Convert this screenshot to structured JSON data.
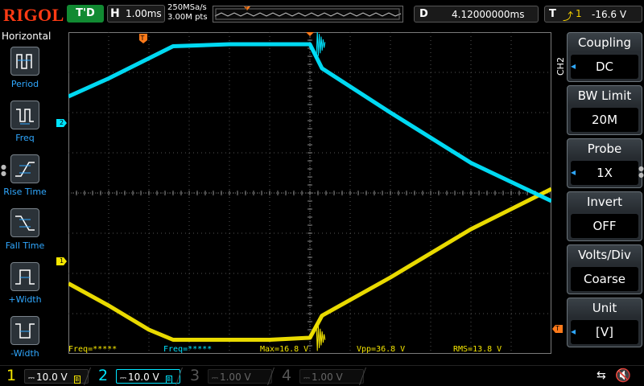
{
  "top": {
    "logo": "RIGOL",
    "run_status": "T'D",
    "timebase_letter": "H",
    "timebase": "1.00ms",
    "sample_rate": "250MSa/s",
    "mem_depth": "3.00M pts",
    "delay_letter": "D",
    "delay": "4.12000000ms",
    "trigger_letter": "T",
    "trigger_source": "1",
    "trigger_level": "-16.6 V"
  },
  "left": {
    "title": "Horizontal",
    "items": [
      {
        "label": "Period"
      },
      {
        "label": "Freq"
      },
      {
        "label": "Rise Time"
      },
      {
        "label": "Fall Time"
      },
      {
        "label": "+Width"
      },
      {
        "label": "-Width"
      }
    ]
  },
  "right": {
    "channel_tag": "CH2",
    "menus": [
      {
        "title": "Coupling",
        "value": "DC",
        "has_arrow": true
      },
      {
        "title": "BW Limit",
        "value": "20M",
        "has_arrow": false
      },
      {
        "title": "Probe",
        "value": "1X",
        "has_arrow": true
      },
      {
        "title": "Invert",
        "value": "OFF",
        "has_arrow": false
      },
      {
        "title": "Volts/Div",
        "value": "Coarse",
        "has_arrow": false
      },
      {
        "title": "Unit",
        "value": "[V]",
        "has_arrow": true
      }
    ]
  },
  "grid_markers": {
    "trigger_pos": "T",
    "ch2_marker": "2",
    "ch1_marker": "1",
    "trig_level_marker": "T"
  },
  "measurements": [
    {
      "text": "Freq=*****",
      "color": "#f5e600"
    },
    {
      "text": "Freq=*****",
      "color": "#00e5ff"
    },
    {
      "text": "Max=16.8 V",
      "color": "#f5e600"
    },
    {
      "text": "Vpp=36.8 V",
      "color": "#f5e600"
    },
    {
      "text": "RMS=13.8 V",
      "color": "#f5e600"
    }
  ],
  "channels": [
    {
      "num": "1",
      "scale": "10.0 V",
      "color": "#f5e600",
      "active": true
    },
    {
      "num": "2",
      "scale": "10.0 V",
      "color": "#00e5ff",
      "active": true
    },
    {
      "num": "3",
      "scale": "1.00 V",
      "color": "#ff40c0",
      "active": false
    },
    {
      "num": "4",
      "scale": "1.00 V",
      "color": "#3a7fff",
      "active": false
    }
  ],
  "colors": {
    "ch1": "#f5e600",
    "ch2": "#00e5ff",
    "trigger_marker": "#ff7a1a",
    "accent": "#30a8ff"
  },
  "chart_data": {
    "type": "line",
    "grid": true,
    "x_divisions": 12,
    "y_divisions": 8,
    "series": [
      {
        "channel": "1",
        "x_div": [
          0,
          1,
          2,
          2.6,
          4,
          5,
          6,
          6.3,
          8,
          10,
          12
        ],
        "y_div": [
          -2.25,
          -2.8,
          -3.4,
          -3.65,
          -3.65,
          -3.65,
          -3.6,
          -3.05,
          -2.1,
          -0.9,
          0.1
        ]
      },
      {
        "channel": "2",
        "x_div": [
          0,
          1,
          2,
          2.6,
          4,
          5,
          6,
          6.3,
          8,
          10,
          12
        ],
        "y_div": [
          2.4,
          2.85,
          3.35,
          3.65,
          3.7,
          3.7,
          3.7,
          3.1,
          2.0,
          0.75,
          -0.2
        ]
      }
    ]
  }
}
